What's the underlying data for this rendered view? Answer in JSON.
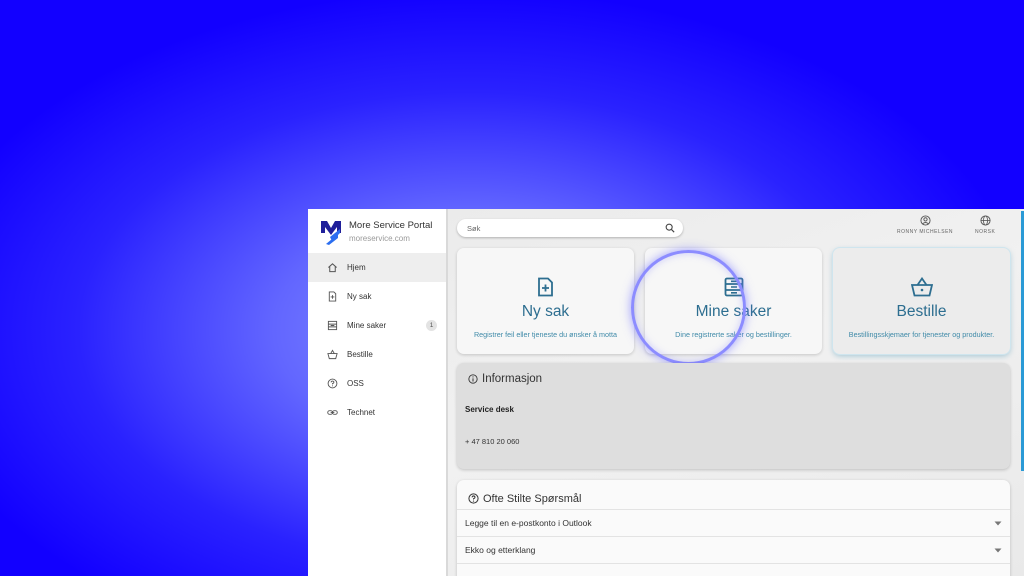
{
  "brand": {
    "title": "More Service Portal",
    "subtitle": "moreservice.com"
  },
  "nav": [
    {
      "label": "Hjem",
      "icon": "home-icon"
    },
    {
      "label": "Ny sak",
      "icon": "new-case-icon"
    },
    {
      "label": "Mine saker",
      "icon": "cases-icon",
      "badge": "1"
    },
    {
      "label": "Bestille",
      "icon": "basket-icon"
    },
    {
      "label": "OSS",
      "icon": "faq-icon"
    },
    {
      "label": "Technet",
      "icon": "link-icon"
    }
  ],
  "search": {
    "placeholder": "Søk"
  },
  "topbar": {
    "user": "RONNY MICHELSEN",
    "language": "NORSK"
  },
  "cards": [
    {
      "title": "Ny sak",
      "desc": "Registrer feil eller tjeneste du ønsker å motta"
    },
    {
      "title": "Mine saker",
      "desc": "Dine registrerte saker og bestillinger."
    },
    {
      "title": "Bestille",
      "desc": "Bestillingsskjemaer for tjenester og produkter."
    }
  ],
  "info": {
    "title": "Informasjon",
    "label": "Service desk",
    "phone": "+ 47 810 20 060"
  },
  "faq": {
    "title": "Ofte Stilte Spørsmål",
    "items": [
      "Legge til en e-postkonto i Outlook",
      "Ekko og etterklang"
    ]
  },
  "colors": {
    "accent": "#2d6e90",
    "background": "#1200ff",
    "highlight_ring": "#8c8cff"
  }
}
